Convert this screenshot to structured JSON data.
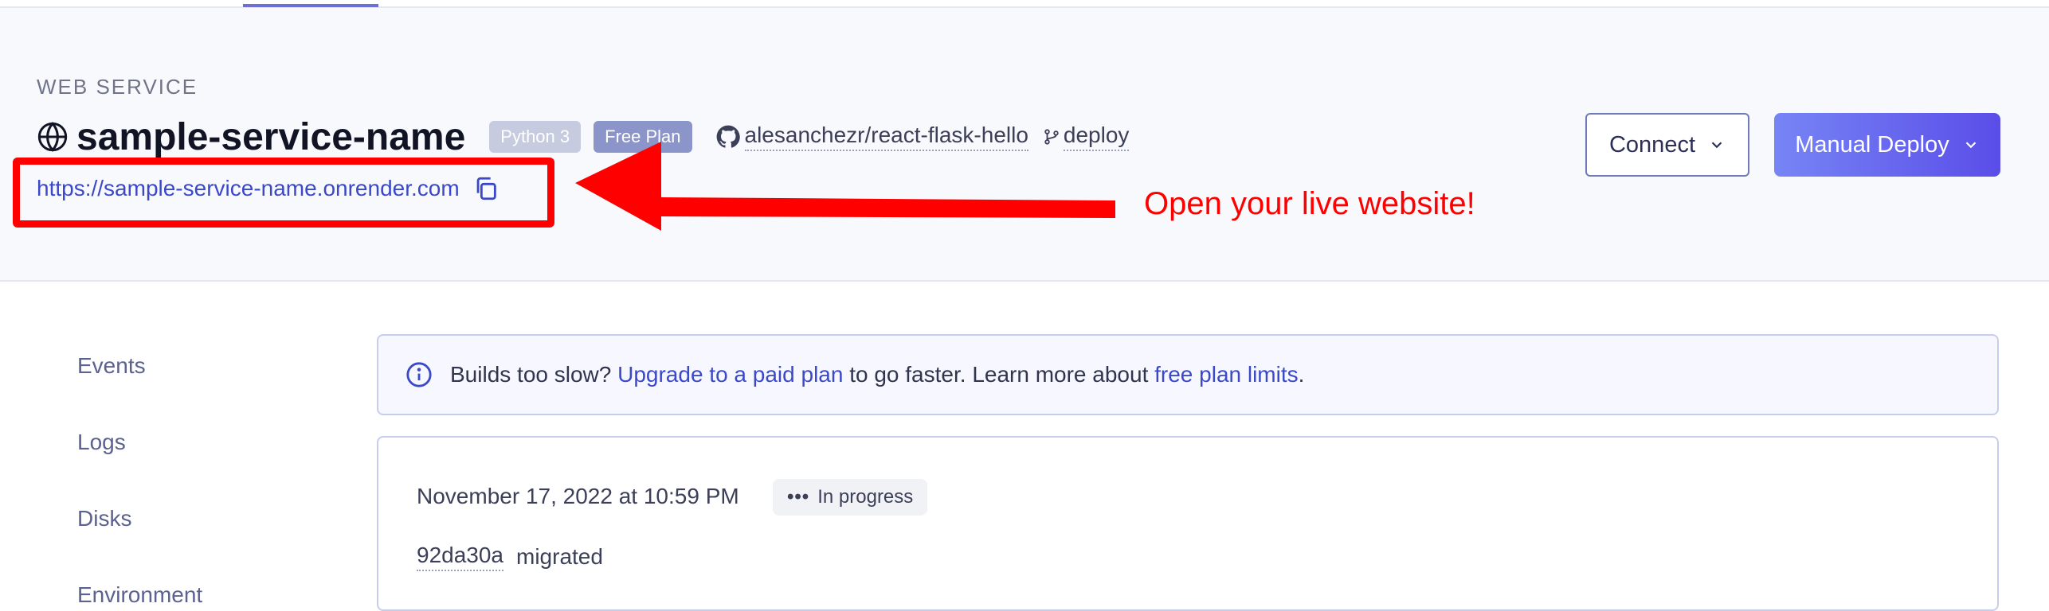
{
  "service": {
    "type_label": "WEB SERVICE",
    "name": "sample-service-name",
    "runtime_badge": "Python 3",
    "plan_badge": "Free Plan",
    "repo": "alesanchezr/react-flask-hello",
    "branch": "deploy",
    "url": "https://sample-service-name.onrender.com"
  },
  "actions": {
    "connect_label": "Connect",
    "manual_deploy_label": "Manual Deploy"
  },
  "annotation": {
    "text": "Open your live website!",
    "color": "#ff0000"
  },
  "sidebar": {
    "items": [
      {
        "label": "Events"
      },
      {
        "label": "Logs"
      },
      {
        "label": "Disks"
      },
      {
        "label": "Environment"
      }
    ]
  },
  "notice": {
    "text_before": "Builds too slow? ",
    "upgrade_link": "Upgrade to a paid plan",
    "text_middle": " to go faster. Learn more about ",
    "limits_link": "free plan limits",
    "text_after": "."
  },
  "deploy": {
    "timestamp": "November 17, 2022 at 10:59 PM",
    "status_dots": "•••",
    "status": "In progress",
    "commit_hash": "92da30a",
    "commit_message": "migrated"
  },
  "colors": {
    "accent": "#5a4de8",
    "link": "#3b49c8",
    "highlight": "#ff0000"
  }
}
